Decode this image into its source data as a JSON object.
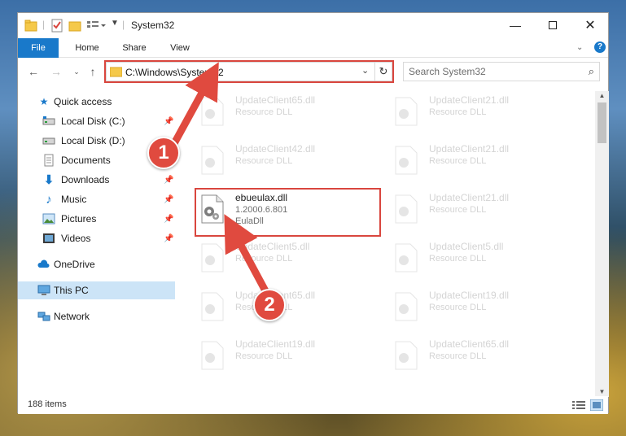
{
  "window": {
    "title": "System32"
  },
  "ribbon": {
    "tabs": [
      "File",
      "Home",
      "Share",
      "View"
    ]
  },
  "address_bar": {
    "path": "C:\\Windows\\System32"
  },
  "search": {
    "placeholder": "Search System32"
  },
  "nav_pane": {
    "items": [
      {
        "label": "Quick access",
        "icon": "star-icon"
      },
      {
        "label": "Local Disk (C:)",
        "icon": "drive-icon",
        "pinned": true
      },
      {
        "label": "Local Disk (D:)",
        "icon": "drive-icon",
        "pinned": false
      },
      {
        "label": "Documents",
        "icon": "documents-icon",
        "pinned": true
      },
      {
        "label": "Downloads",
        "icon": "download-icon",
        "pinned": true
      },
      {
        "label": "Music",
        "icon": "music-icon",
        "pinned": true
      },
      {
        "label": "Pictures",
        "icon": "pictures-icon",
        "pinned": true
      },
      {
        "label": "Videos",
        "icon": "videos-icon",
        "pinned": true
      },
      {
        "label": "OneDrive",
        "icon": "cloud-icon"
      },
      {
        "label": "This PC",
        "icon": "computer-icon",
        "selected": true
      },
      {
        "label": "Network",
        "icon": "network-icon"
      }
    ]
  },
  "files": [
    {
      "name": "UpdateClient65.dll",
      "desc": "Resource DLL"
    },
    {
      "name": "UpdateClient21.dll",
      "desc": "Resource DLL"
    },
    {
      "name": "UpdateClient42.dll",
      "desc": "Resource DLL"
    },
    {
      "name": "UpdateClient21.dll",
      "desc": "Resource DLL"
    },
    {
      "name": "ebueulax.dll",
      "version": "1.2000.6.801",
      "desc": "EulaDll"
    },
    {
      "name": "UpdateClient21.dll",
      "desc": "Resource DLL"
    },
    {
      "name": "UpdateClient5.dll",
      "desc": "Resource DLL"
    },
    {
      "name": "UpdateClient5.dll",
      "desc": "Resource DLL"
    },
    {
      "name": "UpdateClient65.dll",
      "desc": "Resource DLL"
    },
    {
      "name": "UpdateClient19.dll",
      "desc": "Resource DLL"
    },
    {
      "name": "UpdateClient19.dll",
      "desc": "Resource DLL"
    },
    {
      "name": "UpdateClient65.dll",
      "desc": "Resource DLL"
    }
  ],
  "status": {
    "item_count": "188 items"
  },
  "callouts": {
    "one": "1",
    "two": "2"
  },
  "colors": {
    "accent": "#1979ca",
    "highlight": "#d9463e",
    "selection": "#cce4f7"
  }
}
